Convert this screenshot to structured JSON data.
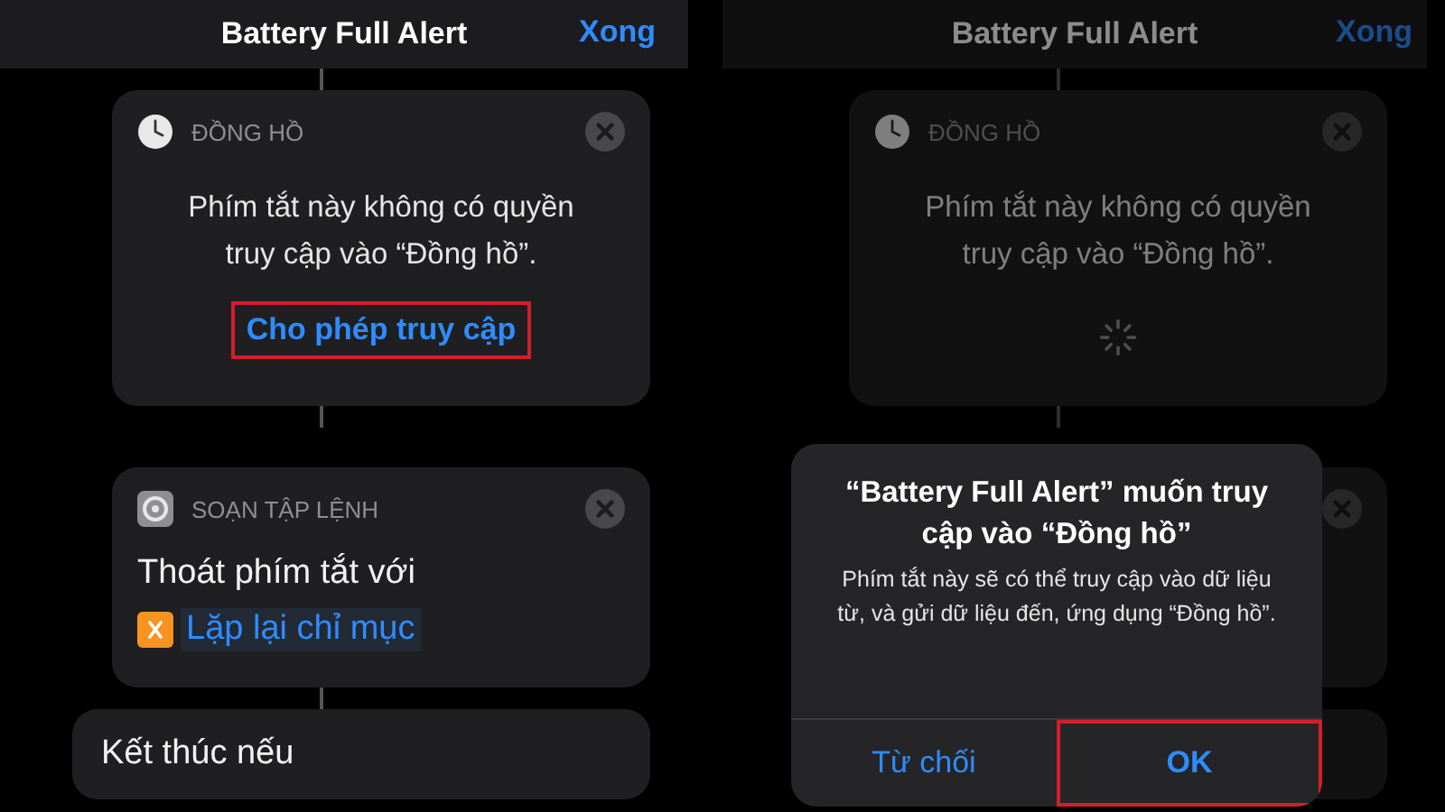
{
  "panels": [
    {
      "dimmed": false,
      "header": {
        "title": "Battery Full Alert",
        "done": "Xong"
      },
      "cards": [
        {
          "kind": "permission",
          "app_label": "ĐỒNG HỒ",
          "message": "Phím tắt này không có quyền truy cập vào “Đồng hồ”.",
          "loading": false,
          "action": {
            "label": "Cho phép truy cập",
            "highlighted": true
          }
        },
        {
          "kind": "script",
          "app_label": "SOẠN TẬP LỆNH",
          "text": "Thoát phím tắt với",
          "variable": "Lặp lại chỉ mục"
        },
        {
          "kind": "plain",
          "text": "Kết thúc nếu"
        }
      ]
    },
    {
      "dimmed": true,
      "header": {
        "title": "Battery Full Alert",
        "done": "Xong"
      },
      "cards": [
        {
          "kind": "permission",
          "app_label": "ĐỒNG HỒ",
          "message": "Phím tắt này không có quyền truy cập vào “Đồng hồ”.",
          "loading": true
        },
        {
          "kind": "covered",
          "closable": true
        },
        {
          "kind": "covered",
          "closable": false
        }
      ],
      "alert": {
        "title": "“Battery Full Alert” muốn truy cập vào “Đồng hồ”",
        "message": "Phím tắt này sẽ có thể truy cập vào dữ liệu từ, và gửi dữ liệu đến, ứng dụng “Đồng hồ”.",
        "buttons": [
          {
            "label": "Từ chối",
            "highlighted": false
          },
          {
            "label": "OK",
            "highlighted": true
          }
        ]
      }
    }
  ]
}
